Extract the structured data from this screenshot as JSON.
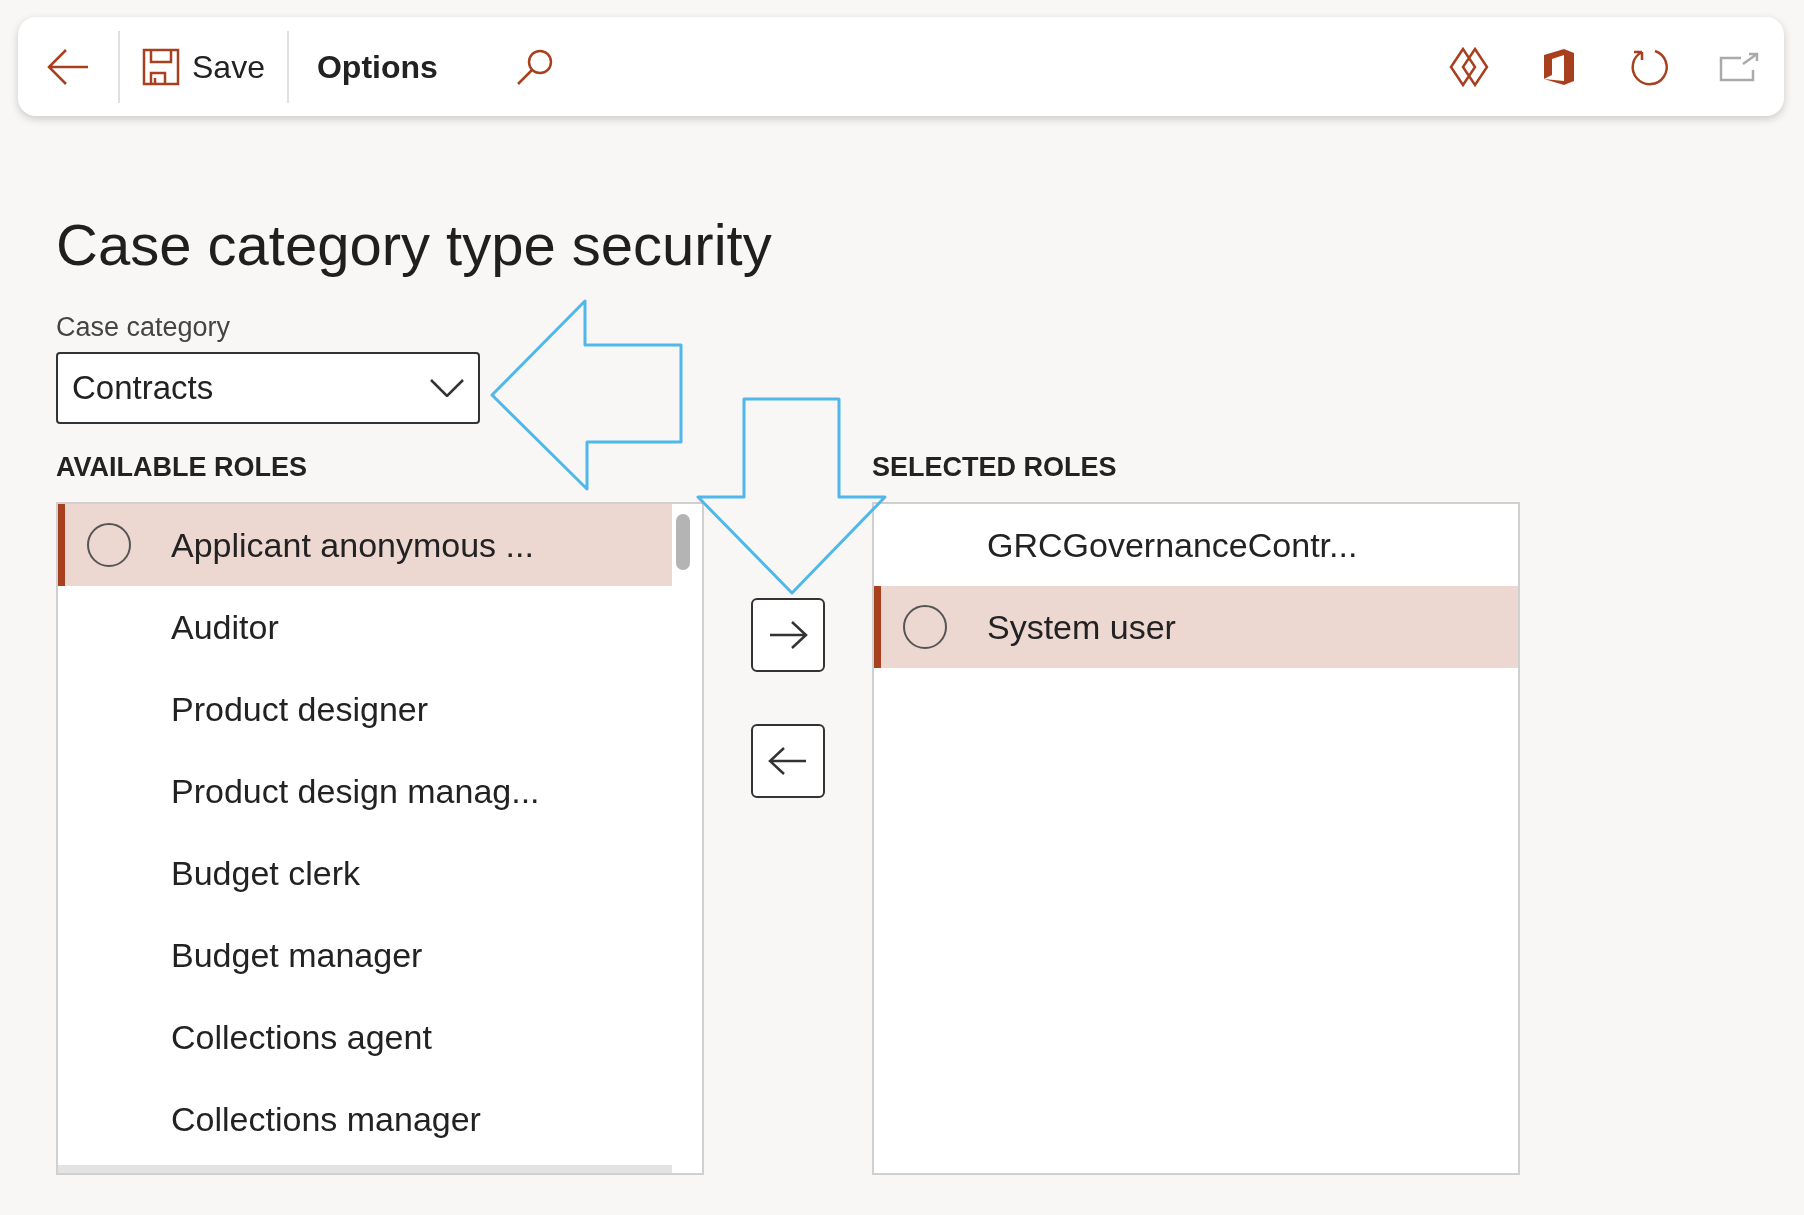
{
  "toolbar": {
    "save": "Save",
    "options": "Options"
  },
  "page_title": "Case category type security",
  "case_category": {
    "label": "Case category",
    "value": "Contracts"
  },
  "available_roles": {
    "heading": "AVAILABLE ROLES",
    "items": [
      {
        "label": "Applicant anonymous ...",
        "selected": true
      },
      {
        "label": "Auditor",
        "selected": false
      },
      {
        "label": "Product designer",
        "selected": false
      },
      {
        "label": "Product design manag...",
        "selected": false
      },
      {
        "label": "Budget clerk",
        "selected": false
      },
      {
        "label": "Budget manager",
        "selected": false
      },
      {
        "label": "Collections agent",
        "selected": false
      },
      {
        "label": "Collections manager",
        "selected": false
      }
    ]
  },
  "selected_roles": {
    "heading": "SELECTED ROLES",
    "items": [
      {
        "label": "GRCGovernanceContr...",
        "selected": false
      },
      {
        "label": "System user",
        "selected": true
      }
    ]
  }
}
